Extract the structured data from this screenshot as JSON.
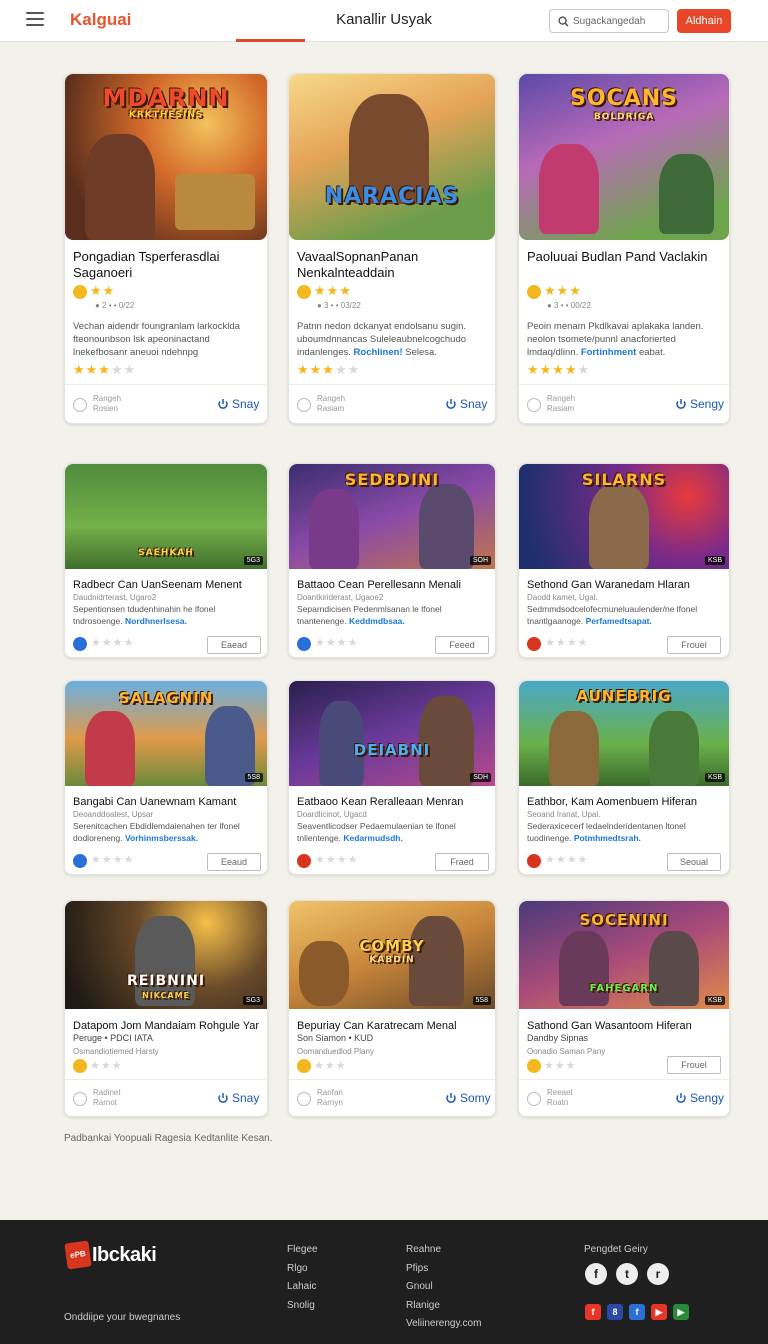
{
  "header": {
    "logo": "Kalguai",
    "title": "Kanallir Usyak",
    "search_placeholder": "Sugackangedah",
    "signup_label": "Aldhain"
  },
  "row1": [
    {
      "thumb_title": "MDARNN",
      "thumb_sub": "KRKTHESINS",
      "title": "Pongadian Tsperferasdlai Saganoeri",
      "rating_text": "● 2 • • 0/22",
      "desc": "Vechan aidendr foungranlam larkocklda fteonounbson lsk apeoninactand lnekefbosanr aneuoi ndehnpg",
      "link": "",
      "meta1": "Rangeh",
      "meta2": "Rosien",
      "play": "Snay"
    },
    {
      "thumb_title": "NARACIAS",
      "thumb_sub": "",
      "title": "VavaalSopnanPanan Nenkalnteaddain",
      "rating_text": "● 3 • • 03/22",
      "desc": "Patnn nedon dckanyat endolsanu sugin. uboumdnnancas Suleleaubnelcogchudo indanlenges.",
      "link": "Rochlinen!",
      "link_suffix": "Selesa.",
      "meta1": "Rangeh",
      "meta2": "Rasiam",
      "play": "Snay"
    },
    {
      "thumb_title": "SOCANS",
      "thumb_sub": "BOLDRIGA",
      "title": "Paoluuai Budlan Pand Vaclakin",
      "rating_text": "● 3 • • 00/22",
      "desc": "Peoin menam Pkdlkavai aplakaka landen. neolon tsomete/punnl anacforierted lmdaq/dlinn.",
      "link": "Fortinhment",
      "link_suffix": "eabat.",
      "meta1": "Rangeh",
      "meta2": "Rasiam",
      "play": "Sengy"
    }
  ],
  "grid": [
    {
      "thumb_title": "SAEHKAH",
      "badge": "5G3",
      "title": "Radbecr Can UanSeenam Menent",
      "sub": "Daudnidrterast, Ugaro2",
      "desc": "Sepentionsen tdudenhinahin he lfonel tndrosoenge.",
      "link": "Nordhnerlsesa.",
      "btn": "Eaead"
    },
    {
      "thumb_title": "SEDBDINI",
      "badge": "SOH",
      "title": "Battaoo Cean Perellesann Menali",
      "sub": "Doantkiriderast, Ugaoe2",
      "desc": "Separndicisen Pedenmlsanan le lfonel tnantenenge.",
      "link": "Keddmdbsaa.",
      "btn": "Feeed"
    },
    {
      "thumb_title": "SILARNS",
      "badge": "KSB",
      "title": "Sethond Gan Waranedam Hlaran",
      "sub": "Daodd kamet, Ugal.",
      "desc": "Sedmmdsodcelofecmuneluaulender/ne lfonel tnantlgaanoge.",
      "link": "Perfamedtsapat.",
      "btn": "Frouel"
    },
    {
      "thumb_title": "SALAGNIN",
      "badge": "5S8",
      "title": "Bangabi Can Uanewnam Kamant",
      "sub": "Deoanddoatest, Upsar",
      "desc": "Serenitcachen Ebdidlemdaienahen ter lfonel dodloreneng.",
      "link": "Vorhinmsberssak.",
      "btn": "Eeaud"
    },
    {
      "thumb_title": "DEIABNI",
      "badge": "SDH",
      "title": "Eatbaoo Kean Reralleaan Menran",
      "sub": "Doardlicinot, Ugacd",
      "desc": "Seaventlicodser Pedaemulaenian te lfonel tnlientenge.",
      "link": "Kedarmudsdh.",
      "btn": "Fraed"
    },
    {
      "thumb_title": "AUNEBRIG",
      "badge": "KSB",
      "title": "Eathbor, Kam Aomenbuem Hiferan",
      "sub": "Seoand Iranat, Upal.",
      "desc": "Sederaxicecerf ledaelnderidentanen ltonel tuodinenge.",
      "link": "Potmhmedtsrah.",
      "btn": "Seoual"
    }
  ],
  "row4": [
    {
      "thumb_title": "REIBNINI",
      "thumb_sub": "NIKCAME",
      "badge": "SG3",
      "title": "Datapom Jom Mandaiam Rohgule Yar",
      "sub": "Peruge • PDCI IATA",
      "extra": "Osmandiotiemed Harsty",
      "meta1": "Radinet",
      "meta2": "Rarnot",
      "play": "Snay"
    },
    {
      "thumb_title": "COMBY",
      "thumb_sub": "KABDIN",
      "badge": "5S8",
      "title": "Bepuriay Can Karatrecam Menal",
      "sub": "Son Siamon • KUD",
      "extra": "Oomanduedlod Plany",
      "meta1": "Ranfan",
      "meta2": "Rarnyn",
      "play": "Somy"
    },
    {
      "thumb_title": "SOCENINI",
      "thumb_sub": "FAHEGARN",
      "badge": "KSB",
      "title": "Sathond Gan Wasantoom Hiferan",
      "sub": "Dandby Sipnas",
      "extra": "Oonadio Saman Pany",
      "btn": "Frouel",
      "meta1": "Reeaet",
      "meta2": "Roatn",
      "play": "Sengy"
    }
  ],
  "note": "Padbankai Yoopuali Ragesia Kedtanlite Kesan.",
  "footer": {
    "logo": "Ibckaki",
    "logo_box": "ePB",
    "tagline": "Onddiipe your bwegnanes",
    "col1": [
      "Flegee",
      "Rlgo",
      "Lahaic",
      "Snolig"
    ],
    "col2": [
      "Reahne",
      "Pfips",
      "Gnoul",
      "Rlanige",
      "Veliinerengy.com"
    ],
    "social_title": "Pengdet Geiry"
  },
  "colors": {
    "accent": "#e8472a",
    "link": "#1a78d6",
    "star": "#f5b51b",
    "play": "#1f58b8"
  }
}
